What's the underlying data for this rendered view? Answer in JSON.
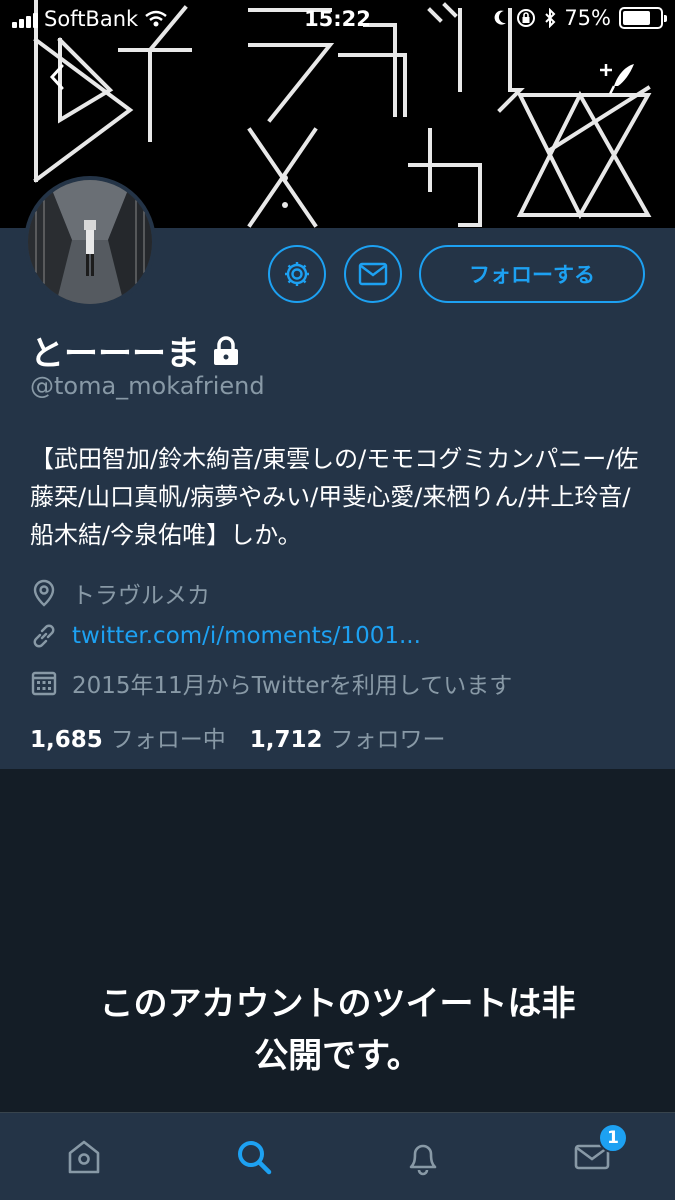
{
  "status_bar": {
    "carrier": "SoftBank",
    "time": "15:22",
    "battery_percent": "75%",
    "battery_level": 0.75
  },
  "profile": {
    "display_name": "とーーーま",
    "handle": "@toma_mokafriend",
    "bio": "【武田智加/鈴木絢音/東雲しの/モモコグミカンパニー/佐藤栞/山口真帆/病夢やみい/甲斐心愛/来栖りん/井上玲音/船木結/今泉佑唯】しか。",
    "location": "トラヴルメカ",
    "website": "twitter.com/i/moments/1001...",
    "joined": "2015年11月からTwitterを利用しています",
    "following_count": "1,685",
    "following_label": "フォロー中",
    "followers_count": "1,712",
    "followers_label": "フォロワー",
    "follow_button": "フォローする",
    "locked": true
  },
  "protected_message": {
    "line1": "このアカウントのツイートは非",
    "line2": "公開です。"
  },
  "tabbar": {
    "items": [
      "home-icon",
      "search-icon",
      "bell-icon",
      "mail-icon"
    ],
    "active": "search-icon",
    "messages_badge": "1"
  },
  "colors": {
    "accent": "#1da1f2",
    "profile_bg": "#243447",
    "page_bg": "#141d26",
    "muted": "#8899a6"
  },
  "icons": {
    "settings": "gear-icon",
    "message": "mail-icon",
    "lock": "lock-icon",
    "location": "location-pin-icon",
    "link": "link-icon",
    "calendar": "calendar-icon"
  }
}
